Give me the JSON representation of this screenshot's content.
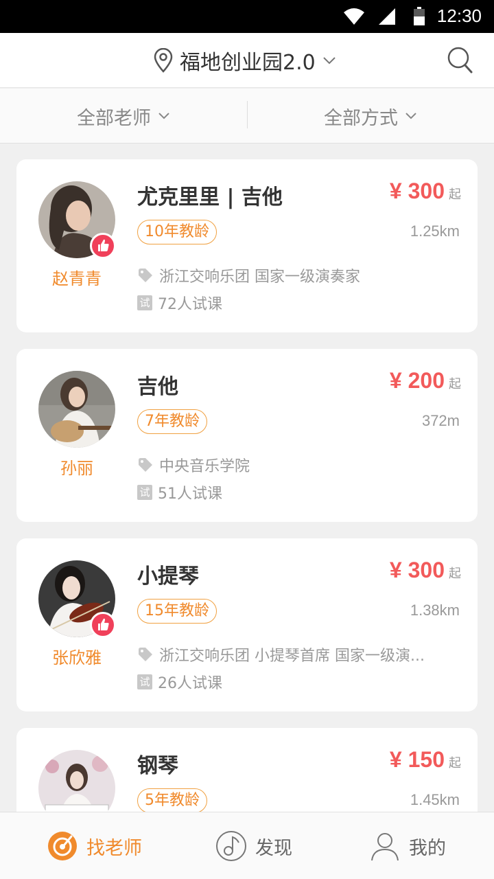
{
  "status_bar": {
    "time": "12:30",
    "icons": [
      "wifi-icon",
      "signal-icon",
      "battery-icon"
    ]
  },
  "header": {
    "location": "福地创业园2.0",
    "icons": [
      "location-pin-icon",
      "chevron-down-icon",
      "search-icon"
    ]
  },
  "filters": {
    "teacher": "全部老师",
    "method": "全部方式"
  },
  "teachers": [
    {
      "name": "赵青青",
      "subject": "尤克里里 | 吉他",
      "price": "¥ 300",
      "price_suffix": "起",
      "experience": "10年教龄",
      "distance": "1.25km",
      "tags": "浙江交响乐团   国家一级演奏家",
      "trial_icon": "试",
      "trial": "72人试课",
      "liked": true
    },
    {
      "name": "孙丽",
      "subject": "吉他",
      "price": "¥ 200",
      "price_suffix": "起",
      "experience": "7年教龄",
      "distance": "372m",
      "tags": "中央音乐学院",
      "trial_icon": "试",
      "trial": "51人试课",
      "liked": false
    },
    {
      "name": "张欣雅",
      "subject": "小提琴",
      "price": "¥ 300",
      "price_suffix": "起",
      "experience": "15年教龄",
      "distance": "1.38km",
      "tags": "浙江交响乐团   小提琴首席   国家一级演...",
      "trial_icon": "试",
      "trial": "26人试课",
      "liked": true
    },
    {
      "name": "",
      "subject": "钢琴",
      "price": "¥ 150",
      "price_suffix": "起",
      "experience": "5年教龄",
      "distance": "1.45km",
      "tags": "",
      "trial_icon": "",
      "trial": "",
      "liked": false
    }
  ],
  "bottom_nav": [
    {
      "label": "找老师",
      "icon": "find-teacher-icon",
      "active": true
    },
    {
      "label": "发现",
      "icon": "discover-music-icon",
      "active": false
    },
    {
      "label": "我的",
      "icon": "profile-icon",
      "active": false
    }
  ],
  "colors": {
    "accent": "#f08a2c",
    "price": "#f25a5a",
    "like_badge": "#f0405a"
  }
}
